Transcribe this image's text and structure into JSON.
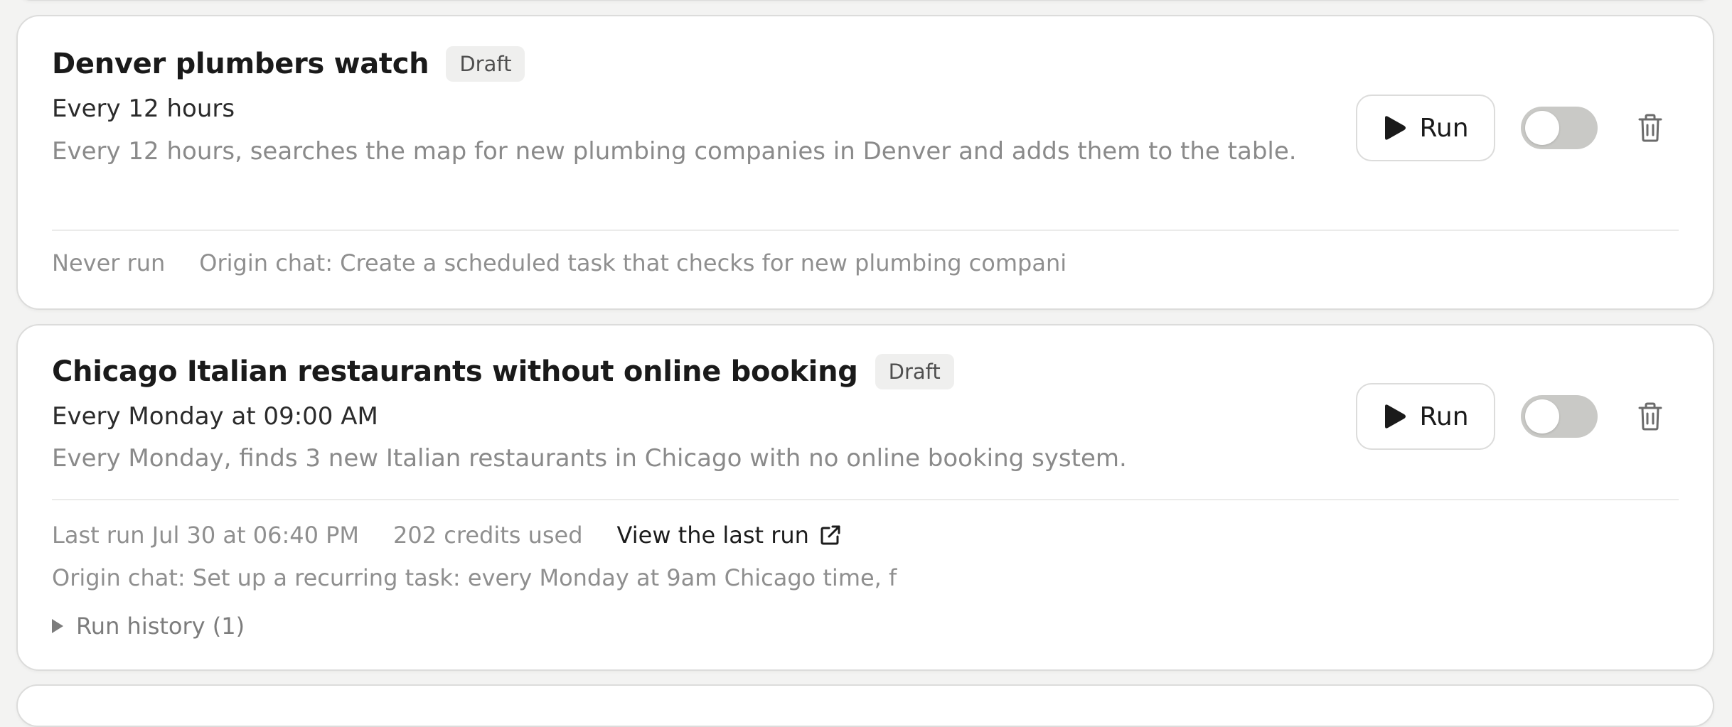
{
  "tasks": [
    {
      "title": "Denver plumbers watch",
      "badge": "Draft",
      "schedule": "Every 12 hours",
      "description": "Every 12 hours, searches the map for new plumbing companies in Denver and adds them to the table.",
      "status": "Never run",
      "origin": "Origin chat: Create a scheduled task that checks for new plumbing compani",
      "run_label": "Run",
      "enabled": false
    },
    {
      "title": "Chicago Italian restaurants without online booking",
      "badge": "Draft",
      "schedule": "Every Monday at 09:00 AM",
      "description": "Every Monday, finds 3 new Italian restaurants in Chicago with no online booking system.",
      "last_run": "Last run Jul 30 at 06:40 PM",
      "credits": "202 credits used",
      "view_last_run": "View the last run",
      "origin": "Origin chat: Set up a recurring task: every Monday at 9am Chicago time, f",
      "run_history": "Run history (1)",
      "run_label": "Run",
      "enabled": false
    }
  ],
  "icons": {
    "run": "play-icon",
    "delete": "trash-icon",
    "external": "external-link-icon",
    "expand": "triangle-right-icon"
  },
  "colors": {
    "toggle_off": "#c9c9c6",
    "muted_text": "#8a8a8a",
    "title_text": "#1a1a1a"
  }
}
